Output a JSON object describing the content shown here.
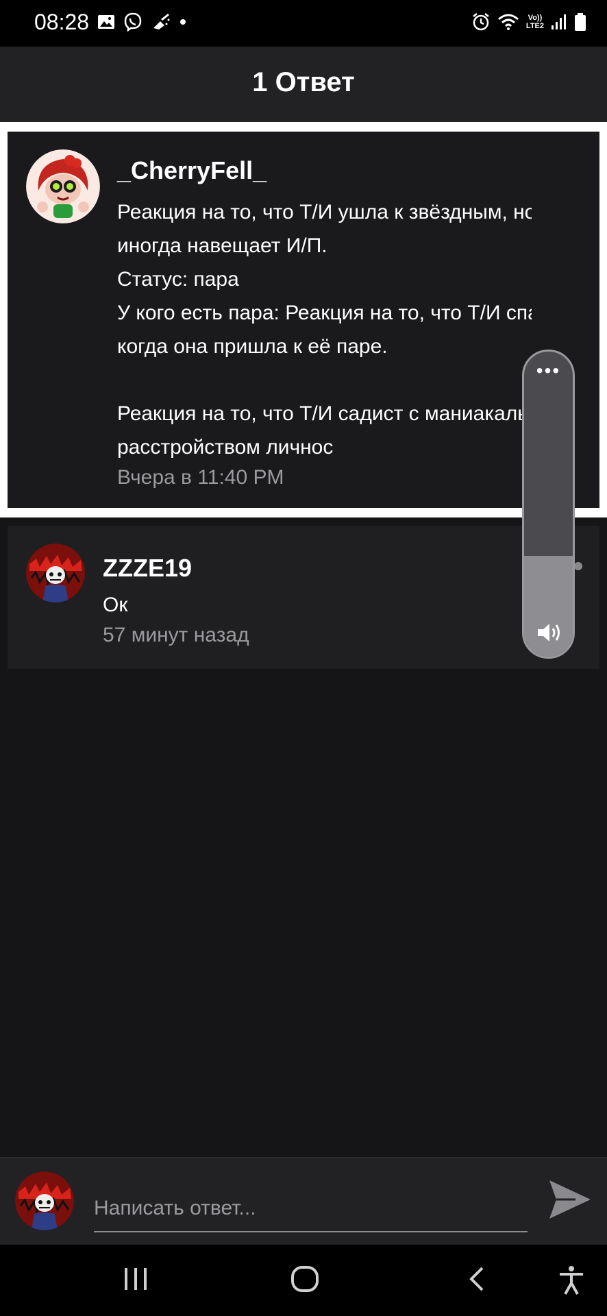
{
  "status_bar": {
    "time": "08:28",
    "left_icons": [
      "gallery-icon",
      "viber-icon",
      "cleaner-icon",
      "dot-icon"
    ],
    "right_icons": [
      "alarm-icon",
      "wifi-icon",
      "volte-icon",
      "signal-icon",
      "battery-icon"
    ],
    "volte_label": "Vo))",
    "lte_label": "LTE2"
  },
  "header": {
    "title": "1 Ответ"
  },
  "parent_comment": {
    "username": "_CherryFell_",
    "text": "Реакция на то, что Т/И ушла к звёздным, но иногда навещает И/П.\nСтатус: пара\nУ кого есть пара: Реакция на то, что Т/И спалил когда она пришла к её паре.\n\nРеакция на то, что Т/И садист с маниакальном расстройством личнос",
    "time": "Вчера в 11:40 PM"
  },
  "reply": {
    "username": "ZZZE19",
    "text": "Ок",
    "time": "57 минут назад"
  },
  "volume_panel": {
    "level": 0.33
  },
  "compose": {
    "placeholder": "Написать ответ..."
  },
  "nav": [
    "recents-icon",
    "home-icon",
    "back-icon",
    "accessibility-icon"
  ],
  "colors": {
    "background": "#151417",
    "header": "#222124",
    "muted_text": "#9b9a9e",
    "card_border": "#ffffff"
  }
}
